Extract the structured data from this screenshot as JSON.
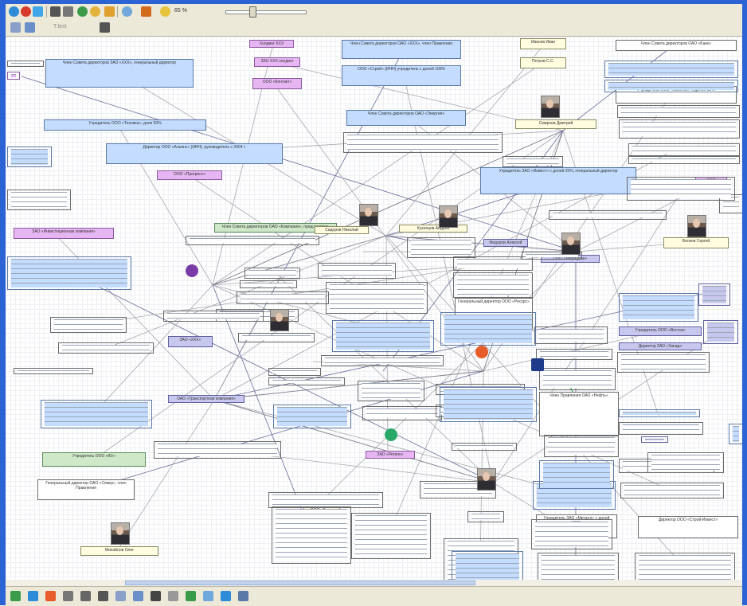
{
  "toolbar": {
    "zoom_value": "65 %",
    "buttons": [
      "open-icon",
      "close-icon",
      "new-icon",
      "binoculars-icon",
      "magnify-icon",
      "globe-icon",
      "star-icon",
      "gear-icon",
      "refresh-icon",
      "arrow-icon",
      "zoom-icon"
    ],
    "row2_label": "Т.text"
  },
  "statusbar": {
    "buttons": [
      "add-node-icon",
      "add-link-icon",
      "wand-icon",
      "copy-icon",
      "print-icon",
      "table-icon",
      "chart-icon",
      "export-icon",
      "cursor-icon",
      "grid-icon",
      "filter-icon",
      "zoom-in-icon",
      "tree-icon",
      "layout-icon"
    ]
  },
  "colors": {
    "window_border": "#2c63d4",
    "canvas_bg": "#ffffff",
    "node_blue": "#c3dcff",
    "node_purple": "#e6b6f2",
    "node_green": "#cfe8c8",
    "node_yellow": "#fffce0",
    "node_lavender": "#c8c8ee"
  },
  "nodes": [
    {
      "name": "node-top-purple-1",
      "text": "Холдинг ХХХ"
    },
    {
      "name": "node-top-purple-2",
      "text": "ЗАО ХХХ холдинг"
    },
    {
      "name": "node-top-purple-3",
      "text": "ООО «Контакт»"
    },
    {
      "name": "node-top-blue-1",
      "text": "Член Совета директоров ОАО «ХХХ», член Правления"
    },
    {
      "name": "node-top-blue-2",
      "text": "ООО «Строй» (ИНН) учредитель с долей 100%"
    },
    {
      "name": "node-top-blue-3",
      "text": "Член Совета директоров ОАО «Энергия»"
    },
    {
      "name": "node-top-yellow-1",
      "text": "Иванов Иван"
    },
    {
      "name": "node-top-yellow-2",
      "text": "Петров С.С."
    },
    {
      "name": "node-left-blue-1",
      "text": "Член Совета директоров ЗАО «ХХХ», генеральный директор"
    },
    {
      "name": "node-left-blue-2",
      "text": "Учредитель ООО «Техника», доля 50%"
    },
    {
      "name": "node-center-blue-1",
      "text": "Директор ООО «Альянс» (ИНН), руководитель с 2004 г."
    },
    {
      "name": "node-center-purple-1",
      "text": "ООО «Прогресс»"
    },
    {
      "name": "node-center-green-1",
      "text": "Член Совета директоров ОАО «Компания», председатель"
    },
    {
      "name": "node-center-yellow-1",
      "text": "Сидоров Николай"
    },
    {
      "name": "node-center-yellow-2",
      "text": "Кузнецов Андрей"
    },
    {
      "name": "node-right-blue-1",
      "text": "Учредитель ЗАО «Инвест» с долей 25%, генеральный директор"
    },
    {
      "name": "node-right-yellow-1",
      "text": "Смирнов Дмитрий"
    },
    {
      "name": "node-right-yellow-2",
      "text": "Волков Сергей"
    },
    {
      "name": "node-right-purple-1",
      "text": "ООО «Сервис»"
    },
    {
      "name": "node-center-lav-1",
      "text": "ООО «Меридиан»"
    },
    {
      "name": "node-center-lav-2",
      "text": "Федоров Алексей"
    },
    {
      "name": "node-left-purple-1",
      "text": "ЗАО «Инвестиционная компания»"
    },
    {
      "name": "node-left-lav-1",
      "text": "ЗАО «ХХХ»"
    },
    {
      "name": "node-left-lav-2",
      "text": "ОАО «Транспортная компания»"
    },
    {
      "name": "node-bottom-yellow-1",
      "text": "Михайлов Олег"
    },
    {
      "name": "node-bottom-yellow-2",
      "text": "ООО «Торг»"
    },
    {
      "name": "node-bottom-purple-1",
      "text": "ЗАО «Регион»"
    },
    {
      "name": "node-bottom-green-1",
      "text": "Учредитель ООО «Юг»"
    },
    {
      "name": "node-bottom-white-1",
      "text": "Генеральный директор ОАО «Север», член Правления"
    },
    {
      "name": "node-right-lav-1",
      "text": "Учредитель ООО «Восток»"
    },
    {
      "name": "node-right-lav-2",
      "text": "Директор ЗАО «Запад»"
    },
    {
      "name": "node-right-white-1",
      "text": "Член Совета директоров ОАО «Банк»"
    },
    {
      "name": "node-right-white-2",
      "text": "Учредитель ООО «Капитал» с долей 33%"
    },
    {
      "name": "node-mid-white-1",
      "text": "Генеральный директор ООО «Ресурс»"
    },
    {
      "name": "node-mid-white-2",
      "text": "Член Правления ОАО «Нефть»"
    },
    {
      "name": "node-mid-white-3",
      "text": "Учредитель ЗАО «Металл» с долей 100%"
    },
    {
      "name": "node-mid-white-4",
      "text": "Директор ООО «Строй-Инвест»"
    }
  ]
}
